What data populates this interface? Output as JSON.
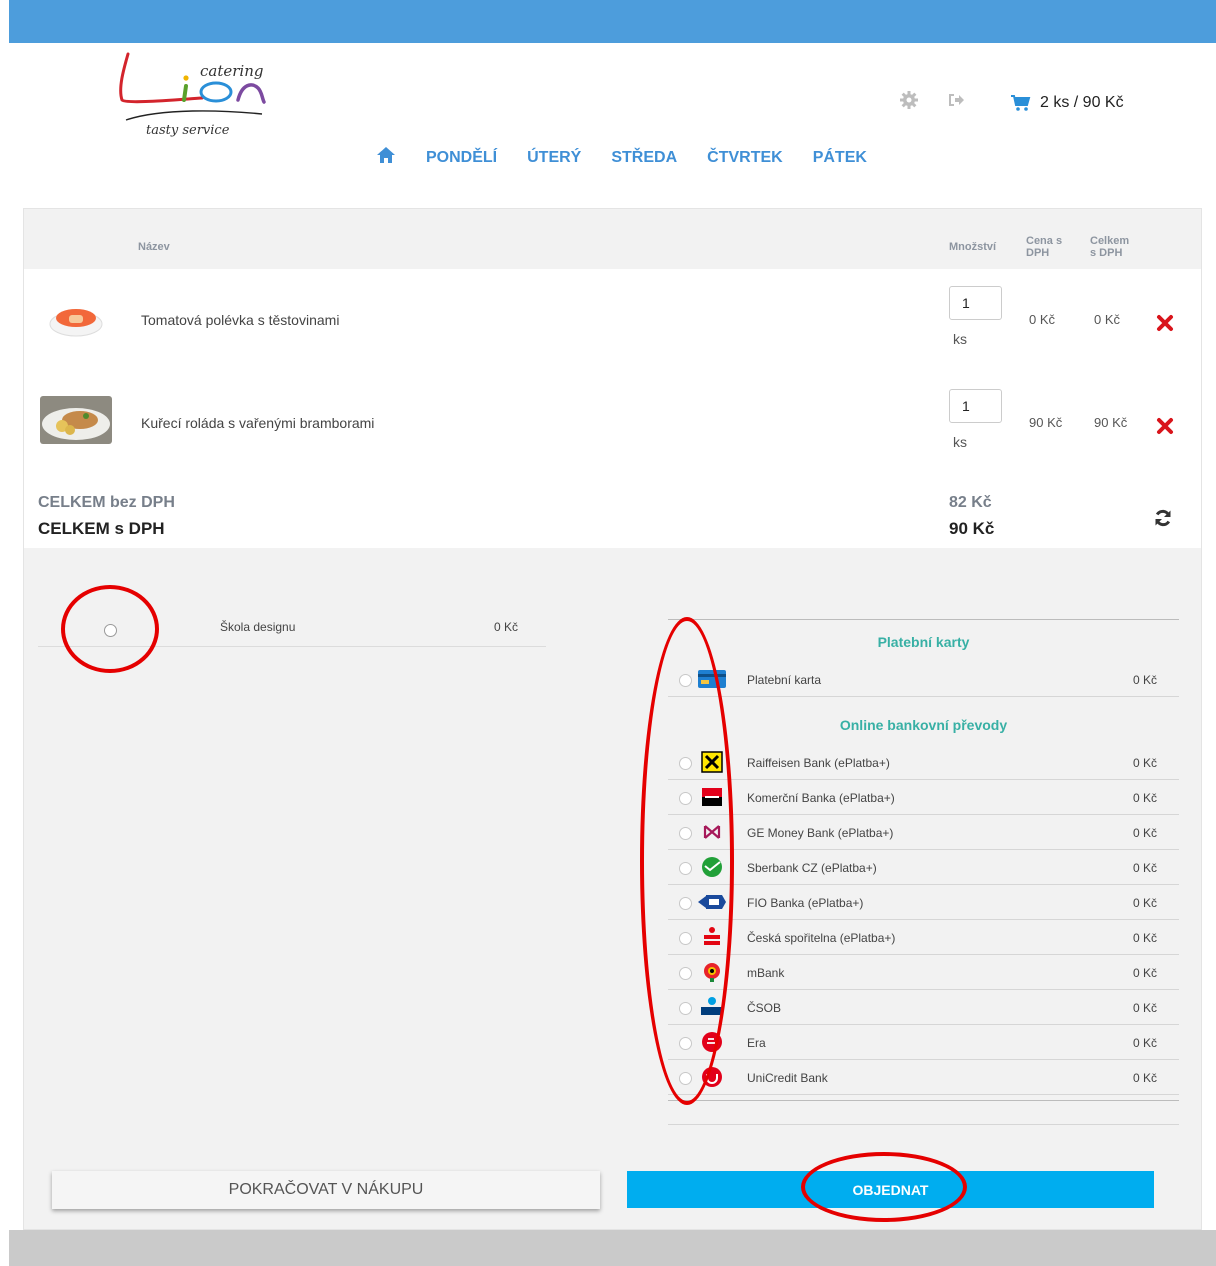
{
  "logo": {
    "small_text": "catering",
    "main_text": "Lion",
    "tagline": "tasty service"
  },
  "header": {
    "icons": [
      "gear-icon",
      "sign-out-icon",
      "cart-icon"
    ],
    "cart_summary": "2 ks / 90 Kč"
  },
  "nav": {
    "home_icon": "home-icon",
    "items": [
      "PONDĚLÍ",
      "ÚTERÝ",
      "STŘEDA",
      "ČTVRTEK",
      "PÁTEK"
    ]
  },
  "cart_table": {
    "headers": {
      "name": "Název",
      "quantity": "Množství",
      "price_line1": "Cena s",
      "price_line2": "DPH",
      "total_line1": "Celkem",
      "total_line2": "s DPH"
    },
    "rows": [
      {
        "name": "Tomatová polévka s těstovinami",
        "quantity": "1",
        "unit": "ks",
        "price": "0 Kč",
        "total": "0 Kč"
      },
      {
        "name": "Kuřecí roláda s vařenými bramborami",
        "quantity": "1",
        "unit": "ks",
        "price": "90 Kč",
        "total": "90 Kč"
      }
    ],
    "summary": {
      "without_vat_label": "CELKEM bez DPH",
      "without_vat_value": "82 Kč",
      "with_vat_label": "CELKEM s DPH",
      "with_vat_value": "90 Kč"
    }
  },
  "shipping": {
    "name": "Škola designu",
    "price": "0 Kč"
  },
  "payments": {
    "card_heading": "Platební karty",
    "card": {
      "name": "Platební karta",
      "price": "0 Kč"
    },
    "bank_heading": "Online bankovní převody",
    "banks": [
      {
        "name": "Raiffeisen Bank (ePlatba+)",
        "price": "0 Kč"
      },
      {
        "name": "Komerční Banka (ePlatba+)",
        "price": "0 Kč"
      },
      {
        "name": "GE Money Bank (ePlatba+)",
        "price": "0 Kč"
      },
      {
        "name": "Sberbank CZ (ePlatba+)",
        "price": "0 Kč"
      },
      {
        "name": "FIO Banka (ePlatba+)",
        "price": "0 Kč"
      },
      {
        "name": "Česká spořitelna (ePlatba+)",
        "price": "0 Kč"
      },
      {
        "name": "mBank",
        "price": "0 Kč"
      },
      {
        "name": "ČSOB",
        "price": "0 Kč"
      },
      {
        "name": "Era",
        "price": "0 Kč"
      },
      {
        "name": "UniCredit Bank",
        "price": "0 Kč"
      }
    ]
  },
  "buttons": {
    "continue": "POKRAČOVAT V NÁKUPU",
    "order": "OBJEDNAT"
  },
  "colors": {
    "top_bar": "#4d9ddc",
    "nav_link": "#3f8fd6",
    "payment_heading": "#38b0a5",
    "order_button": "#00adef",
    "annotation": "#e50000"
  }
}
